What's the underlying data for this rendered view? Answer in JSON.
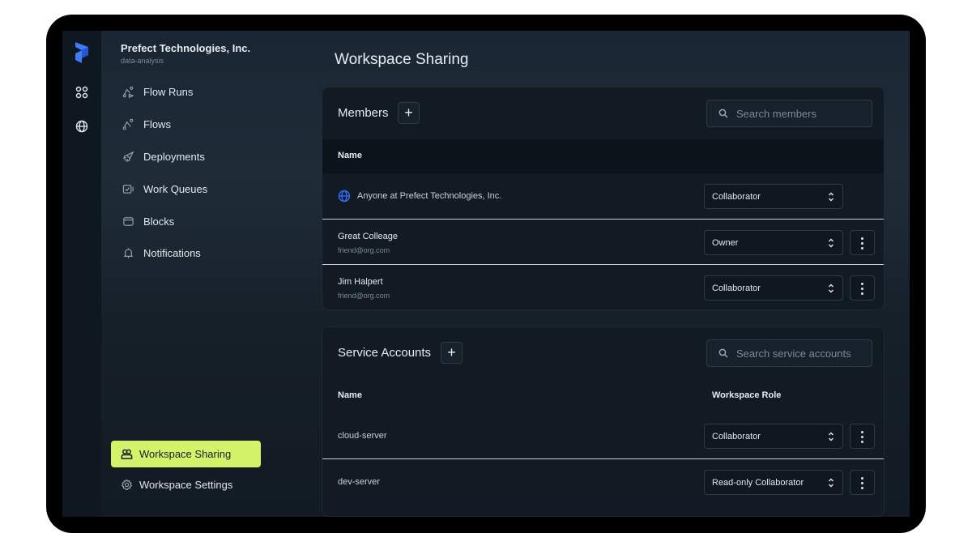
{
  "org": {
    "name": "Prefect Technologies, Inc.",
    "workspace": "data-analysis"
  },
  "nav": {
    "items": [
      {
        "label": "Flow Runs",
        "icon": "flow-runs-icon"
      },
      {
        "label": "Flows",
        "icon": "flows-icon"
      },
      {
        "label": "Deployments",
        "icon": "rocket-icon"
      },
      {
        "label": "Work Queues",
        "icon": "work-queue-icon"
      },
      {
        "label": "Blocks",
        "icon": "blocks-icon"
      },
      {
        "label": "Notifications",
        "icon": "bell-icon"
      }
    ],
    "active": {
      "label": "Workspace Sharing",
      "icon": "users-icon"
    },
    "settings": {
      "label": "Workspace Settings",
      "icon": "gear-icon"
    }
  },
  "page": {
    "title": "Workspace Sharing"
  },
  "members": {
    "title": "Members",
    "add_label": "+",
    "search_placeholder": "Search members",
    "col_name": "Name",
    "rows": [
      {
        "name": "Anyone at Prefect Technologies, Inc.",
        "email": "",
        "role": "Collaborator",
        "kebab": false
      },
      {
        "name": "Great Colleage",
        "email": "friend@org.com",
        "role": "Owner",
        "kebab": true
      },
      {
        "name": "Jim Halpert",
        "email": "friend@org.com",
        "role": "Collaborator",
        "kebab": true
      }
    ]
  },
  "service_accounts": {
    "title": "Service Accounts",
    "add_label": "+",
    "search_placeholder": "Search service accounts",
    "col_name": "Name",
    "col_role": "Workspace Role",
    "rows": [
      {
        "name": "cloud-server",
        "role": "Collaborator"
      },
      {
        "name": "dev-server",
        "role": "Read-only Collaborator"
      }
    ]
  },
  "colors": {
    "accent": "#d4f36a",
    "brand_blue": "#2d6df6",
    "background": "#121b24"
  }
}
